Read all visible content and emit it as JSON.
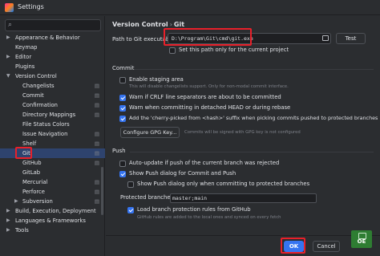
{
  "window": {
    "title": "Settings"
  },
  "sidebar": {
    "search_icon": "search-icon",
    "items": [
      {
        "label": "Appearance & Behavior",
        "expanded": false
      },
      {
        "label": "Keymap"
      },
      {
        "label": "Editor",
        "expanded": false
      },
      {
        "label": "Plugins"
      },
      {
        "label": "Version Control",
        "expanded": true
      },
      {
        "label": "Changelists"
      },
      {
        "label": "Commit"
      },
      {
        "label": "Confirmation"
      },
      {
        "label": "Directory Mappings"
      },
      {
        "label": "File Status Colors"
      },
      {
        "label": "Issue Navigation"
      },
      {
        "label": "Shelf"
      },
      {
        "label": "Git",
        "selected": true
      },
      {
        "label": "GitHub"
      },
      {
        "label": "GitLab"
      },
      {
        "label": "Mercurial"
      },
      {
        "label": "Perforce"
      },
      {
        "label": "Subversion",
        "expanded": false
      },
      {
        "label": "Build, Execution, Deployment",
        "expanded": false
      },
      {
        "label": "Languages & Frameworks",
        "expanded": false
      },
      {
        "label": "Tools",
        "expanded": false
      }
    ]
  },
  "breadcrumb": {
    "parent": "Version Control",
    "separator": "›",
    "current": "Git"
  },
  "git_path": {
    "label": "Path to Git executable:",
    "value": "D:\\Program\\Git\\cmd\\git.exe",
    "test_button": "Test",
    "project_only_label": "Set this path only for the current project",
    "project_only_checked": false
  },
  "commit_section": {
    "title": "Commit",
    "staging_label": "Enable staging area",
    "staging_checked": false,
    "staging_hint": "This will disable changelists support. Only for non-modal commit interface.",
    "crlf_label": "Warn if CRLF line separators are about to be committed",
    "crlf_checked": true,
    "detached_label": "Warn when committing in detached HEAD or during rebase",
    "detached_checked": true,
    "cherry_label": "Add the 'cherry-picked from <hash>' suffix when picking commits pushed to protected branches",
    "cherry_checked": true,
    "gpg_button": "Configure GPG Key...",
    "gpg_hint": "Commits will be signed with GPG key is not configured"
  },
  "push_section": {
    "title": "Push",
    "auto_update_label": "Auto-update if push of the current branch was rejected",
    "auto_update_checked": false,
    "show_push_label": "Show Push dialog for Commit and Push",
    "show_push_checked": true,
    "protected_only_label": "Show Push dialog only when committing to protected branches",
    "protected_only_checked": false,
    "protected_branches_label": "Protected branches:",
    "protected_branches_value": "master;main",
    "load_rules_label": "Load branch protection rules from GitHub",
    "load_rules_checked": true,
    "load_rules_hint": "GitHub rules are added to the local ones and synced on every fetch"
  },
  "footer": {
    "ok_label": "OK",
    "cancel_label": "Cancel",
    "corner_badge": "OE"
  },
  "colors": {
    "background": "#2b2d30",
    "selection": "#2e436e",
    "accent": "#3574f0",
    "highlight_box": "#e8202a"
  }
}
